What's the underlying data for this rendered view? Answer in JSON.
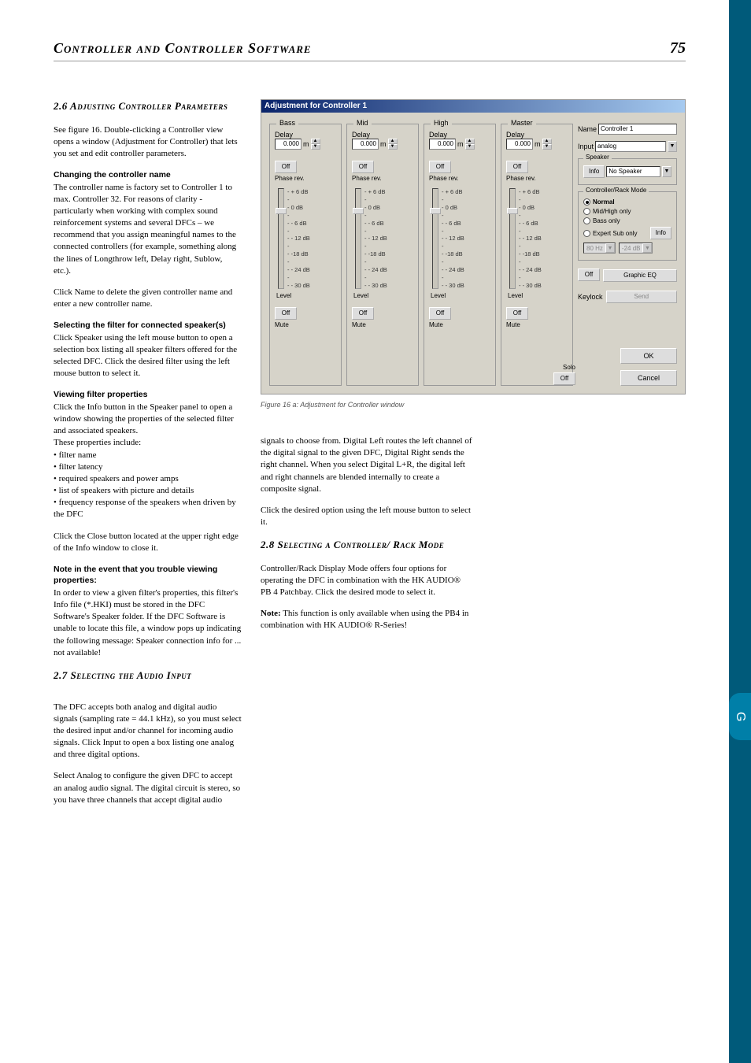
{
  "header": {
    "title": "Controller and Controller Software",
    "page_num": "75"
  },
  "tab": "G",
  "sec26": {
    "heading": "2.6 Adjusting Controller Parameters",
    "p1": "See figure 16. Double-clicking a Controller view opens a window (Adjustment for Controller) that lets you set and edit controller parameters.",
    "sub1": "Changing the controller name",
    "p2": "The controller name is factory set to Controller 1 to max. Controller 32. For reasons of clarity - particularly when working with complex sound reinforcement systems and several DFCs – we recommend that you assign meaningful names to the connected controllers (for example, something along the lines of Longthrow left, Delay right, Sublow, etc.).",
    "p3": "Click Name to delete the given controller name and enter a new controller name.",
    "sub2": "Selecting the filter for connected speaker(s)",
    "p4": "Click Speaker using the left mouse button to open a selection box listing all speaker filters offered for the selected DFC. Click the desired filter using the left mouse button to select it.",
    "sub3": "Viewing filter properties",
    "p5": "Click the Info button in the Speaker panel to open a window showing the properties of the selected filter and associated speakers.",
    "p6": "These properties include:",
    "bullets": [
      "filter name",
      "filter latency",
      "required speakers and power amps",
      "list of speakers with picture and details",
      "frequency response of the speakers when driven by the DFC"
    ],
    "p7": "Click the Close button located at the upper right edge of the Info window to close it.",
    "sub4": "Note in the event that you trouble viewing properties:",
    "p8": "In order to view a given filter's properties, this filter's Info file (*.HKI) must be stored in the DFC Software's Speaker folder. If the DFC Software is unable to locate this file, a window pops up indicating the following message: Speaker connection info for ... not available!"
  },
  "sec27": {
    "heading": "2.7 Selecting the Audio Input",
    "p1": "The DFC accepts both analog and digital audio signals (sampling rate = 44.1 kHz), so you must select the desired input and/or channel for incoming audio signals. Click Input to open a box listing one analog and three digital options.",
    "p2": "Select Analog to configure the given DFC to accept an analog audio signal. The digital circuit is stereo, so you have three channels that accept digital audio",
    "p3": "signals to choose from. Digital Left routes the left channel of the digital signal to the given DFC, Digital Right sends the right channel. When you select Digital L+R, the digital left and right channels are blended internally to create a composite signal.",
    "p4": "Click the desired option using the left mouse button to select it."
  },
  "sec28": {
    "heading": "2.8 Selecting a Controller/ Rack Mode",
    "p1": "Controller/Rack Display Mode offers four options for operating the DFC in combination with the HK AUDIO® PB 4 Patchbay. Click the desired mode to select it.",
    "p2a": "Note:",
    "p2b": " This function is only available when using the PB4 in combination with HK AUDIO® R-Series!"
  },
  "fig": {
    "title": "Adjustment for Controller 1",
    "caption": "Figure 16 a: Adjustment for Controller window",
    "channels": [
      "Bass",
      "Mid",
      "High",
      "Master"
    ],
    "delay_label": "Delay",
    "delay_val": "0.000",
    "unit": "m",
    "off": "Off",
    "phase": "Phase rev.",
    "ticks": [
      "- + 6 dB",
      "-",
      "- 0 dB",
      "-",
      "- - 6 dB",
      "-",
      "- - 12 dB",
      "-",
      "- -18 dB",
      "-",
      "- - 24 dB",
      "-",
      "- - 30 dB"
    ],
    "level": "Level",
    "mute": "Mute",
    "solo": "Solo",
    "name_label": "Name",
    "name_val": "Controller 1",
    "input_label": "Input",
    "input_val": "analog",
    "speaker_legend": "Speaker",
    "info_btn": "Info",
    "speaker_val": "No Speaker",
    "mode_legend": "Controller/Rack Mode",
    "modes": [
      "Normal",
      "Mid/High only",
      "Bass only",
      "Expert Sub only"
    ],
    "mode_info": "Info",
    "dd1": "80 Hz",
    "dd2": "-24 dB",
    "geq": "Graphic EQ",
    "keylock": "Keylock",
    "send": "Send",
    "ok": "OK",
    "cancel": "Cancel"
  }
}
